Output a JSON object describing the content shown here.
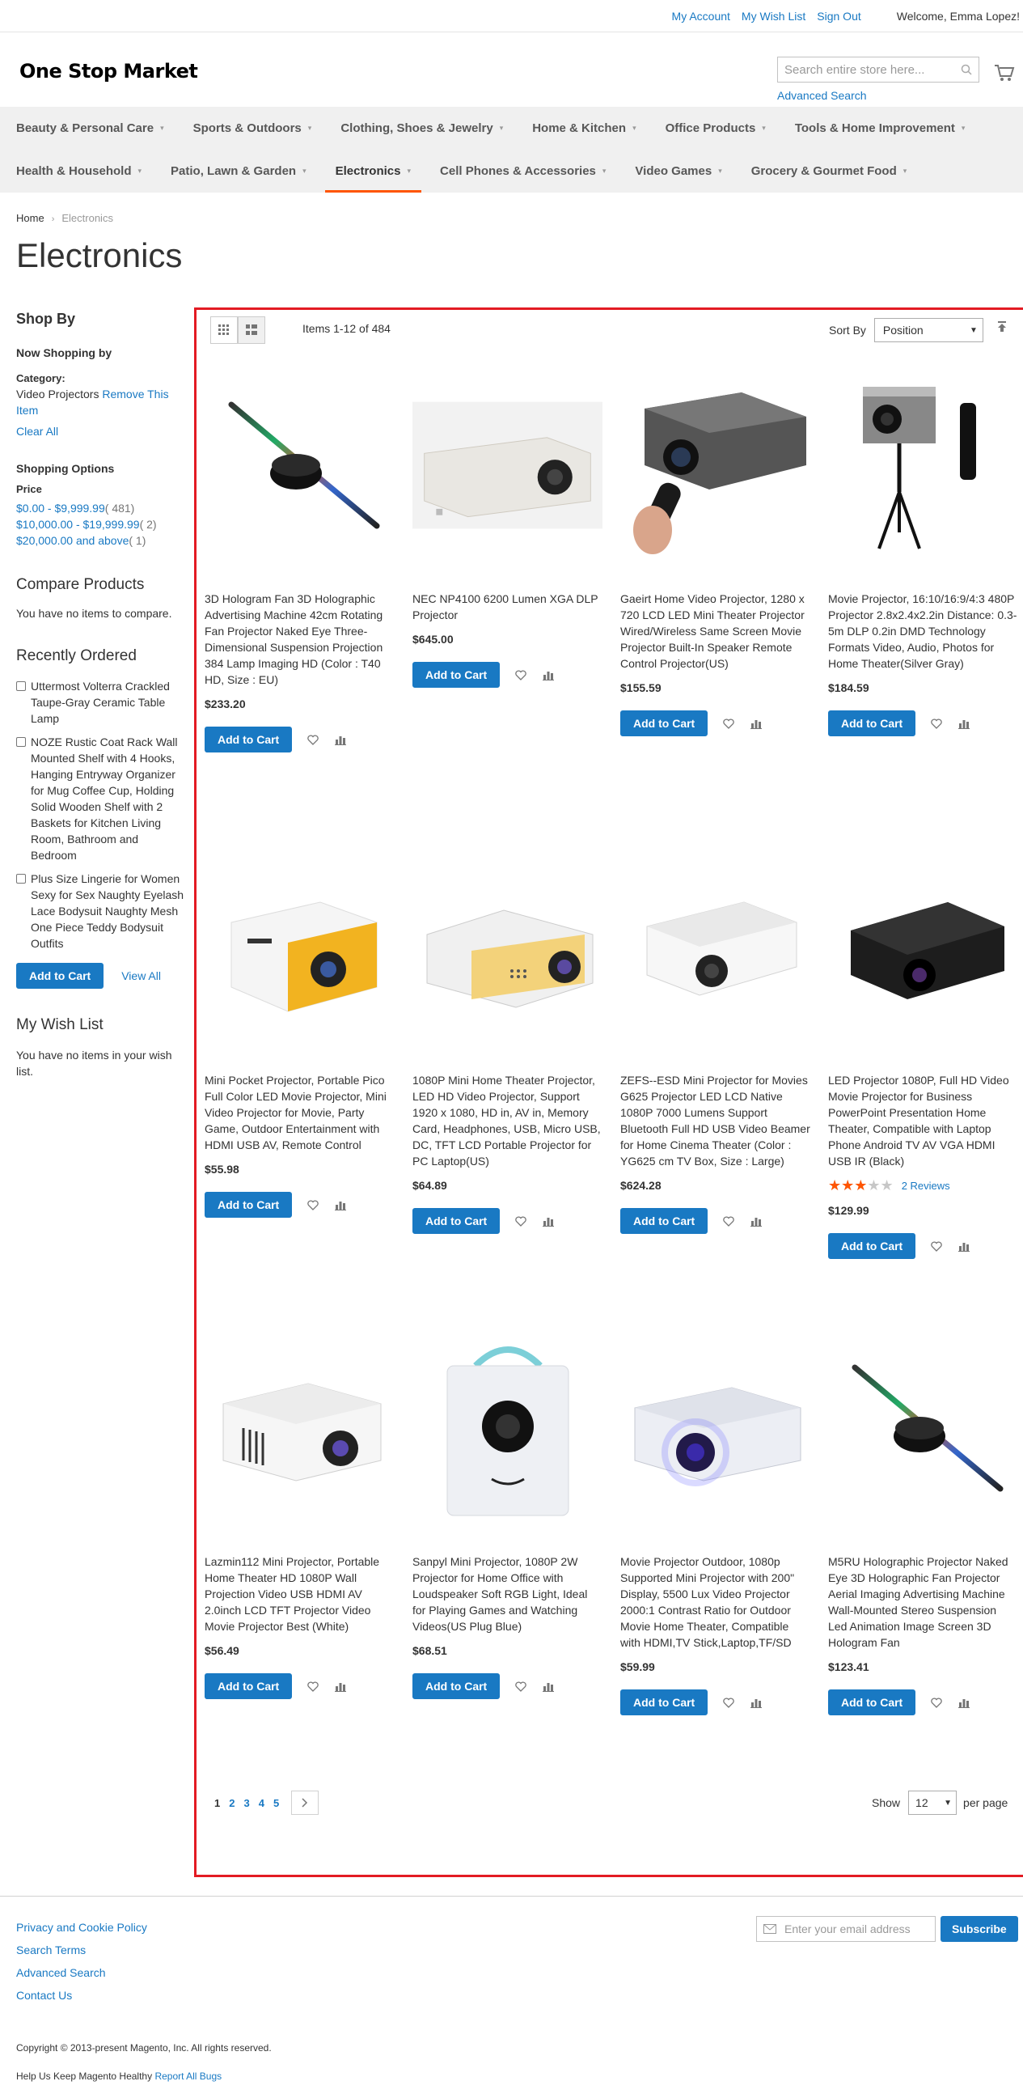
{
  "header": {
    "links": [
      "My Account",
      "My Wish List",
      "Sign Out"
    ],
    "welcome": "Welcome, Emma Lopez!",
    "logo": "One Stop Market",
    "search_placeholder": "Search entire store here...",
    "advanced_search": "Advanced Search"
  },
  "nav": {
    "row1": [
      "Beauty & Personal Care",
      "Sports & Outdoors",
      "Clothing, Shoes & Jewelry",
      "Home & Kitchen",
      "Office Products",
      "Tools & Home Improvement"
    ],
    "row2": [
      "Health & Household",
      "Patio, Lawn & Garden",
      "Electronics",
      "Cell Phones & Accessories",
      "Video Games",
      "Grocery & Gourmet Food"
    ]
  },
  "breadcrumb": {
    "home": "Home",
    "current": "Electronics"
  },
  "page_title": "Electronics",
  "sidebar": {
    "shop_by": "Shop By",
    "now_shopping": "Now Shopping by",
    "category_label": "Category:",
    "category_value": "Video Projectors",
    "remove": "Remove This Item",
    "clear_all": "Clear All",
    "shopping_options": "Shopping Options",
    "price_label": "Price",
    "price_ranges": [
      {
        "range": "$0.00 - $9,999.99",
        "count": "( 481)"
      },
      {
        "range": "$10,000.00 - $19,999.99",
        "count": "( 2)"
      },
      {
        "range": "$20,000.00 and above",
        "count": "( 1)"
      }
    ],
    "compare_title": "Compare Products",
    "compare_empty": "You have no items to compare.",
    "recent_title": "Recently Ordered",
    "recent_items": [
      "Uttermost Volterra Crackled Taupe-Gray Ceramic Table Lamp",
      "NOZE Rustic Coat Rack Wall Mounted Shelf with 4 Hooks, Hanging Entryway Organizer for Mug Coffee Cup, Holding Solid Wooden Shelf with 2 Baskets for Kitchen Living Room, Bathroom and Bedroom",
      "Plus Size Lingerie for Women Sexy for Sex Naughty Eyelash Lace Bodysuit Naughty Mesh One Piece Teddy Bodysuit Outfits"
    ],
    "add_to_cart": "Add to Cart",
    "view_all": "View All",
    "wishlist_title": "My Wish List",
    "wishlist_empty": "You have no items in your wish list."
  },
  "toolbar": {
    "amount": "Items 1-12 of 484",
    "sort_by": "Sort By",
    "sort_value": "Position"
  },
  "products": [
    {
      "name": "3D Hologram Fan 3D Holographic Advertising Machine 42cm Rotating Fan Projector Naked Eye Three-Dimensional Suspension Projection 384 Lamp Imaging HD (Color : T40 HD, Size : EU)",
      "price": "$233.20",
      "image": "hologram-fan"
    },
    {
      "name": "NEC NP4100 6200 Lumen XGA DLP Projector",
      "price": "$645.00",
      "image": "white-office-projector"
    },
    {
      "name": "Gaeirt Home Video Projector, 1280 x 720 LCD LED Mini Theater Projector Wired/Wireless Same Screen Movie Projector Built-In Speaker Remote Control Projector(US)",
      "price": "$155.59",
      "image": "gray-projector-remote"
    },
    {
      "name": "Movie Projector, 16:10/16:9/4:3 480P Projector 2.8x2.4x2.2in Distance: 0.3-5m DLP 0.2in DMD Technology Formats Video, Audio, Photos for Home Theater(Silver Gray)",
      "price": "$184.59",
      "image": "tripod-projector"
    },
    {
      "name": "Mini Pocket Projector, Portable Pico Full Color LED Movie Projector, Mini Video Projector for Movie, Party Game, Outdoor Entertainment with HDMI USB AV, Remote Control",
      "price": "$55.98",
      "image": "yellow-cube-projector"
    },
    {
      "name": "1080P Mini Home Theater Projector, LED HD Video Projector, Support 1920 x 1080, HD in, AV in, Memory Card, Headphones, USB, Micro USB, DC, TFT LCD Portable Projector for PC Laptop(US)",
      "price": "$64.89",
      "image": "yellow-mini-projector"
    },
    {
      "name": "ZEFS--ESD Mini Projector for Movies G625 Projector LED LCD Native 1080P 7000 Lumens Support Bluetooth Full HD USB Video Beamer for Home Cinema Theater (Color : YG625 cm TV Box, Size : Large)",
      "price": "$624.28",
      "image": "white-home-projector"
    },
    {
      "name": "LED Projector 1080P, Full HD Video Movie Projector for Business PowerPoint Presentation Home Theater, Compatible with Laptop Phone Android TV AV VGA HDMI USB IR (Black)",
      "price": "$129.99",
      "rating": 60,
      "reviews": "2  Reviews",
      "image": "black-projector"
    },
    {
      "name": "Lazmin112 Mini Projector, Portable Home Theater HD 1080P Wall Projection Video USB HDMI AV 2.0inch LCD TFT Projector Video Movie Projector Best (White)",
      "price": "$56.49",
      "image": "white-mini-projector"
    },
    {
      "name": "Sanpyl Mini Projector, 1080P 2W Projector for Home Office with Loudspeaker Soft RGB Light, Ideal for Playing Games and Watching Videos(US Plug Blue)",
      "price": "$68.51",
      "image": "cube-face-projector"
    },
    {
      "name": "Movie Projector Outdoor, 1080p Supported Mini Projector with 200\" Display, 5500 Lux Video Projector 2000:1 Contrast Ratio for Outdoor Movie Home Theater, Compatible with HDMI,TV Stick,Laptop,TF/SD",
      "price": "$59.99",
      "image": "silver-outdoor-projector"
    },
    {
      "name": "M5RU Holographic Projector Naked Eye 3D Holographic Fan Projector Aerial Imaging Advertising Machine Wall-Mounted Stereo Suspension Led Animation Image Screen 3D Hologram Fan",
      "price": "$123.41",
      "image": "hologram-fan"
    }
  ],
  "product_add_to_cart": "Add to Cart",
  "pager": {
    "current": "1",
    "pages": [
      "2",
      "3",
      "4",
      "5"
    ],
    "show": "Show",
    "limit": "12",
    "per_page": "per page"
  },
  "footer": {
    "links": [
      "Privacy and Cookie Policy",
      "Search Terms",
      "Advanced Search",
      "Contact Us"
    ],
    "email_placeholder": "Enter your email address",
    "subscribe": "Subscribe",
    "copyright": "Copyright © 2013-present Magento, Inc. All rights reserved.",
    "help_text": "Help Us Keep Magento Healthy",
    "report_bugs": "Report All Bugs"
  },
  "colors": {
    "link": "#1979c3",
    "accent": "#ff5501",
    "highlight_border": "#e31b23"
  }
}
